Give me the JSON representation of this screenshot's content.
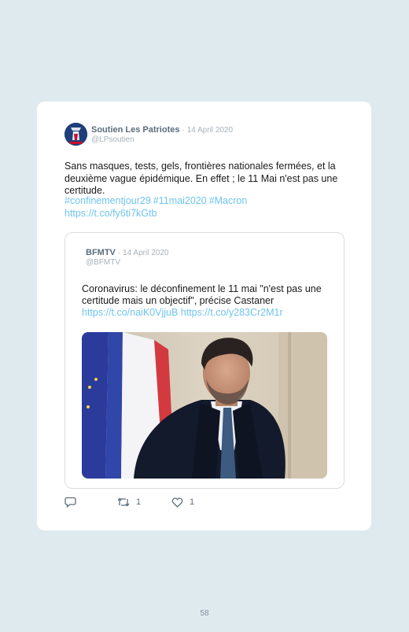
{
  "tweet": {
    "author_name": "Soutien Les Patriotes",
    "date": "· 14 April 2020",
    "handle": "@LPsoutien",
    "text": "Sans masques, tests, gels, frontières nationales fermées, et la deuxième vague épidémique. En effet ; le 11 Mai n'est pas une certitude.",
    "hashtags": [
      "#confinementjour29",
      "#11mai2020",
      "#Macron"
    ],
    "link": "https://t.co/fy6ti7kGtb"
  },
  "quoted": {
    "author_name": "BFMTV",
    "date": "· 14 April 2020",
    "handle": "@BFMTV",
    "text": "Coronavirus: le déconfinement le 11 mai \"n'est pas une certitude mais un objectif\", précise Castaner",
    "links": "https://t.co/naiK0VjjuB https://t.co/y283Cr2M1r"
  },
  "actions": {
    "reply_count": "",
    "retweet_count": "1",
    "like_count": "1"
  },
  "page": {
    "number": "58"
  },
  "colors": {
    "background": "#dfeaef",
    "link": "#6fc4ef",
    "name": "#5b6d7b"
  }
}
